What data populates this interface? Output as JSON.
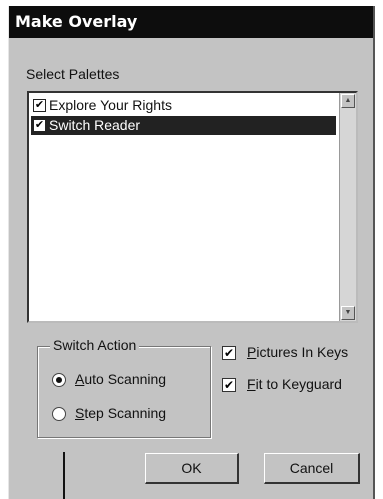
{
  "dialog": {
    "title": "Make Overlay",
    "select_label": "Select Palettes",
    "palettes": [
      {
        "label": "Explore Your Rights",
        "checked": true,
        "selected": false
      },
      {
        "label": "Switch Reader",
        "checked": true,
        "selected": true
      }
    ],
    "switch_action": {
      "legend": "Switch Action",
      "options": [
        {
          "accel": "A",
          "rest": "uto Scanning",
          "selected": true
        },
        {
          "accel": "S",
          "rest": "tep Scanning",
          "selected": false
        }
      ]
    },
    "options": [
      {
        "accel": "P",
        "rest": "ictures In Keys",
        "checked": true
      },
      {
        "accel": "F",
        "rest": "it to Keyguard",
        "checked": true
      }
    ],
    "buttons": {
      "ok": "OK",
      "cancel": "Cancel"
    }
  },
  "icons": {
    "check_mark": "✔",
    "scroll_up": "▲",
    "scroll_down": "▼"
  }
}
